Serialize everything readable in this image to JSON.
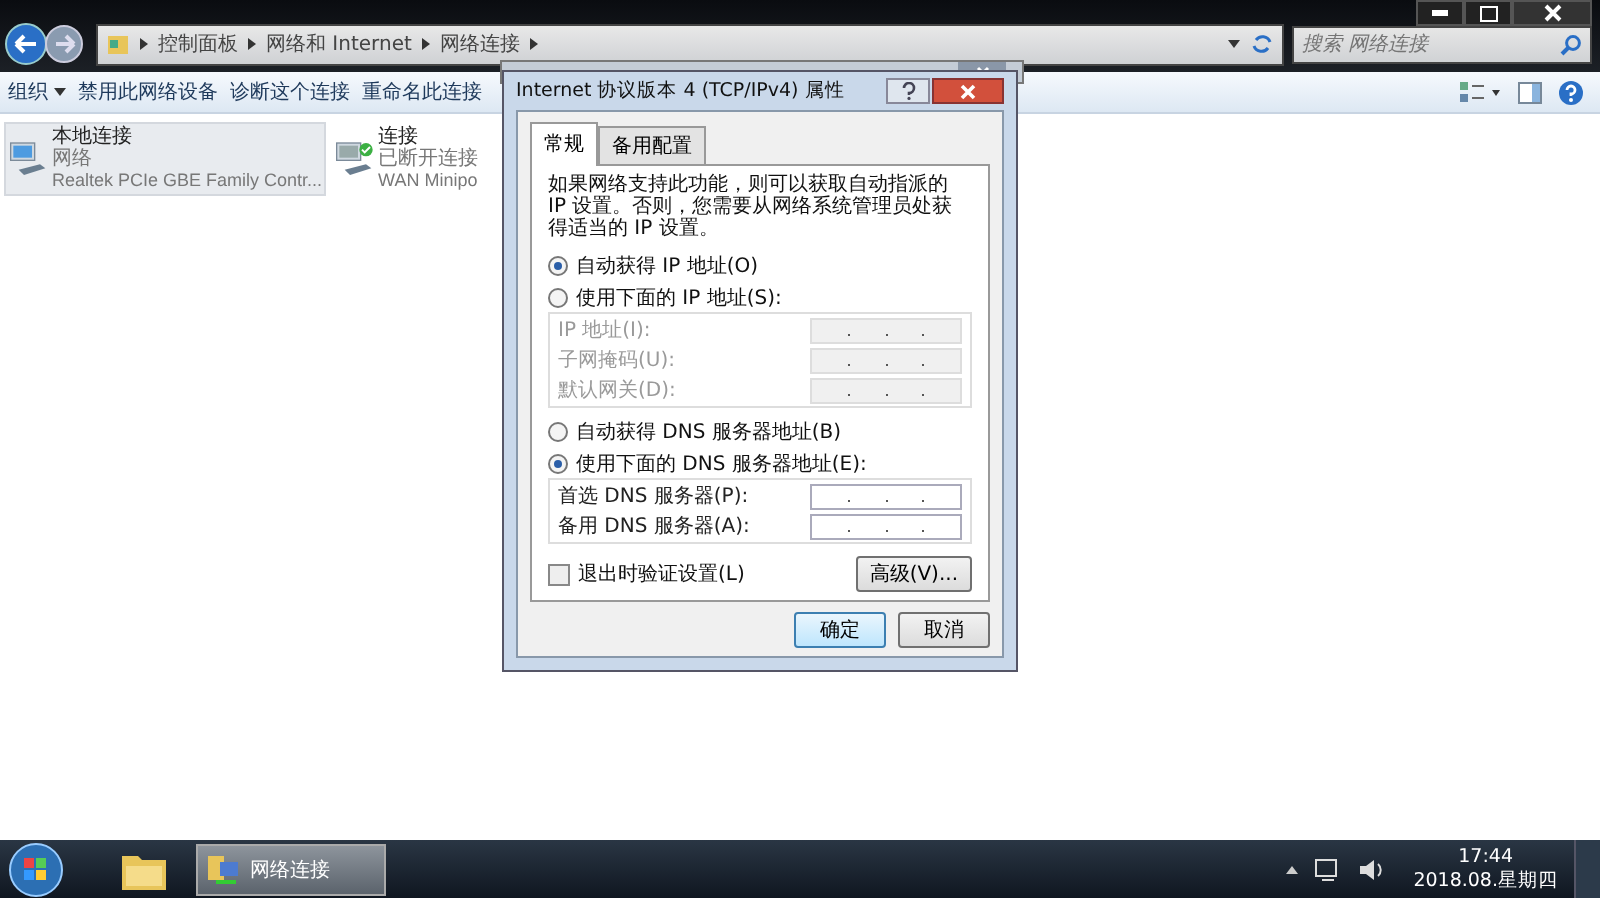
{
  "explorer": {
    "breadcrumb": [
      "控制面板",
      "网络和 Internet",
      "网络连接"
    ],
    "search": {
      "placeholder": "搜索 网络连接"
    },
    "toolbar": [
      "组织",
      "禁用此网络设备",
      "诊断这个连接",
      "重命名此连接"
    ],
    "connections": [
      {
        "name": "本地连接",
        "status": "网络",
        "device": "Realtek PCIe GBE Family Contr...",
        "selected": true,
        "connected": false
      },
      {
        "name": "连接",
        "status": "已断开连接",
        "device": "WAN Minipo",
        "selected": false,
        "connected": true
      }
    ]
  },
  "dialog": {
    "title": "Internet 协议版本 4 (TCP/IPv4) 属性",
    "tabs": [
      {
        "label": "常规",
        "selected": true
      },
      {
        "label": "备用配置",
        "selected": false
      }
    ],
    "description": "如果网络支持此功能，则可以获取自动指派的 IP 设置。否则，您需要从网络系统管理员处获得适当的 IP 设置。",
    "ip_options": [
      {
        "label": "自动获得 IP 地址(O)",
        "selected": true
      },
      {
        "label": "使用下面的 IP 地址(S):",
        "selected": false
      }
    ],
    "ip_fields": [
      {
        "label": "IP 地址(I):",
        "disabled": true
      },
      {
        "label": "子网掩码(U):",
        "disabled": true
      },
      {
        "label": "默认网关(D):",
        "disabled": true
      }
    ],
    "dns_options": [
      {
        "label": "自动获得 DNS 服务器地址(B)",
        "selected": false
      },
      {
        "label": "使用下面的 DNS 服务器地址(E):",
        "selected": true
      }
    ],
    "dns_fields": [
      {
        "label": "首选 DNS 服务器(P):",
        "disabled": false
      },
      {
        "label": "备用 DNS 服务器(A):",
        "disabled": false
      }
    ],
    "validate": {
      "label": "退出时验证设置(L)",
      "checked": false
    },
    "advanced_button": "高级(V)...",
    "buttons": [
      "确定",
      "取消"
    ]
  },
  "taskbar": {
    "task": "网络连接",
    "time": "17:44",
    "date": "2018.08.星期四"
  }
}
